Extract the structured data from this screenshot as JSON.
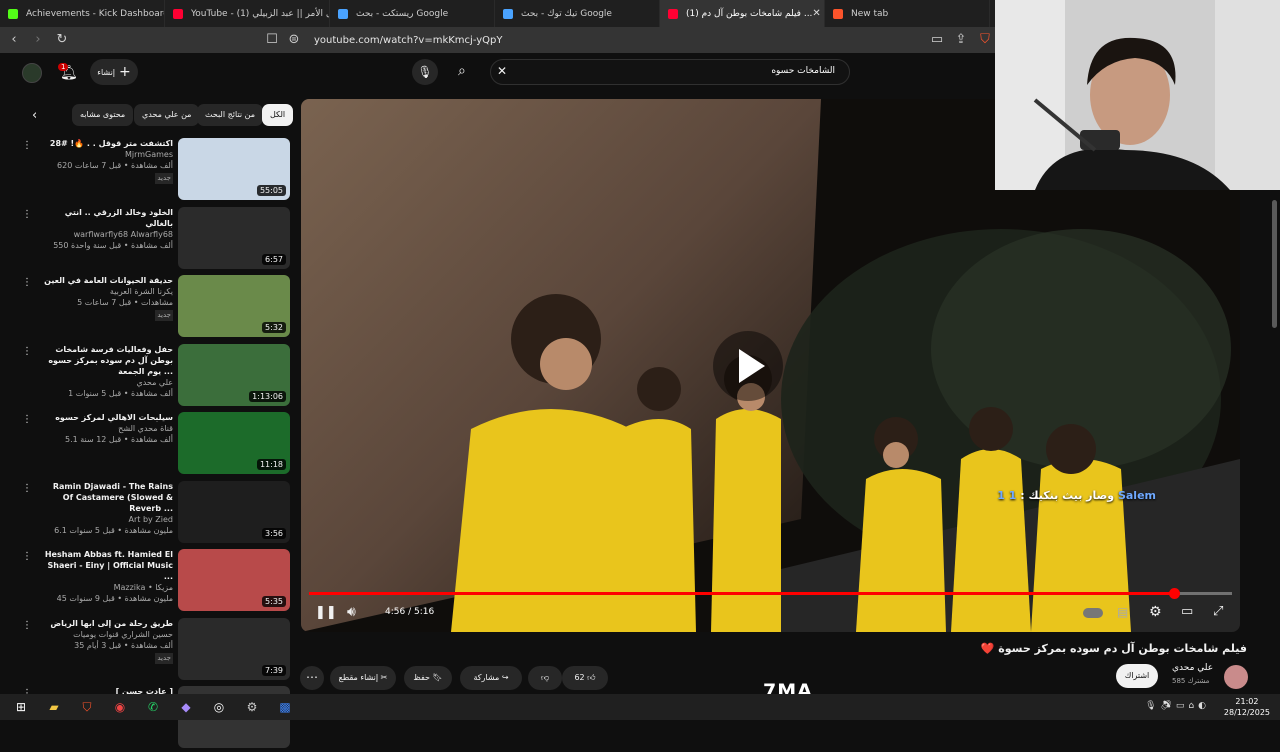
{
  "tabs": [
    {
      "title": "Achievements - Kick Dashboard",
      "fav": "#53fc18"
    },
    {
      "title": "YouTube - (1) موال الأمر || عبد الزبيلي",
      "fav": "#ff0033"
    },
    {
      "title": "ريستكت - بحث Google",
      "fav": "#4aa3ff"
    },
    {
      "title": "تيك توك - بحث Google",
      "fav": "#4aa3ff"
    },
    {
      "title": "(1) فيلم شامخات بوطن آل دم ...",
      "fav": "#ff0033"
    },
    {
      "title": "New tab",
      "fav": "#fb542b"
    }
  ],
  "address": {
    "url": "youtube.com/watch?v=mkKmcj-yQpY"
  },
  "header": {
    "search_value": "الشامخات حسوه",
    "create_label": "إنشاء",
    "notif_count": "1"
  },
  "chips": [
    "الكل",
    "من نتائج البحث",
    "من علي محدي",
    "محتوى مشابه"
  ],
  "recos": [
    {
      "title": "اكتشفت متر قوقل . . 🔥! #28",
      "channel": "MjrmGames",
      "views": "620 ألف مشاهدة • قبل 7 ساعات",
      "new": "جديد",
      "duration": "55:05",
      "color": "#c9d7e6"
    },
    {
      "title": "الخلود وخالد الزرقي .. انتي بالغالي",
      "channel": "warflwarfly68 Alwarfly68",
      "views": "550 ألف مشاهدة • قبل سنة واحدة",
      "new": "",
      "duration": "6:57",
      "color": "#2b2b2b"
    },
    {
      "title": "حديقة الحيوانات العامة في العين",
      "channel": "يكرنا الشرة العربية",
      "views": "5 مشاهدات • قبل 7 ساعات",
      "new": "جديد",
      "duration": "5:32",
      "color": "#6a8a4a"
    },
    {
      "title": "حفل وفعاليات فرسة شامخات بوطن آل دم سوده بمركز حسوه يوم الجمعة ...",
      "channel": "علي محدي",
      "views": "1 ألف مشاهدة • قبل 5 سنوات",
      "new": "",
      "duration": "1:13:06",
      "color": "#3b6e3b"
    },
    {
      "title": "سيلبحات الاهالي لمركز حسوه",
      "channel": "قناة محدي الشح",
      "views": "5.1 ألف مشاهدة • قبل 12 سنة",
      "new": "",
      "duration": "11:18",
      "color": "#1c6b2a"
    },
    {
      "title": "Ramin Djawadi - The Rains Of Castamere (Slowed & Reverb ...",
      "channel": "Art by Zied",
      "views": "6.1 مليون مشاهدة • قبل 5 سنوات",
      "new": "",
      "duration": "3:56",
      "color": "#1e1e1e"
    },
    {
      "title": "Hesham Abbas ft. Hamied El Shaeri - Einy | Official Music ...",
      "channel": "Mazzika • مزيكا",
      "views": "45 مليون مشاهدة • قبل 9 سنوات",
      "new": "",
      "duration": "5:35",
      "color": "#b84a4a"
    },
    {
      "title": "طريق رحلة من إلى ابها الرياض",
      "channel": "حسين الشراري قنوات يوميات",
      "views": "35 ألف مشاهدة • قبل 3 أيام",
      "new": "جديد",
      "duration": "7:39",
      "color": "#2a2a2a"
    },
    {
      "title": "[ عادت حسن ]",
      "channel": "",
      "views": "",
      "new": "",
      "duration": "",
      "color": "#333333"
    }
  ],
  "player": {
    "time": "4:56 / 5:16",
    "progress": 0.937,
    "overlay_text": "وصار بيث بنكيك : ",
    "overlay_name": "1 1 Salem"
  },
  "video": {
    "title": "فيلم شامخات بوطن آل دم سوده بمركز حسوة ❤️"
  },
  "actions": {
    "like_count": "62",
    "share": "مشاركة",
    "save": "حفظ",
    "clip": "إنشاء مقطع"
  },
  "owner": {
    "name": "علي محدي",
    "subs": "585 مشترك",
    "subscribe": "اشتراك"
  },
  "overlay": {
    "brand": "7MA"
  },
  "taskbar": {
    "time": "21:02",
    "date": "28/12/2025"
  }
}
